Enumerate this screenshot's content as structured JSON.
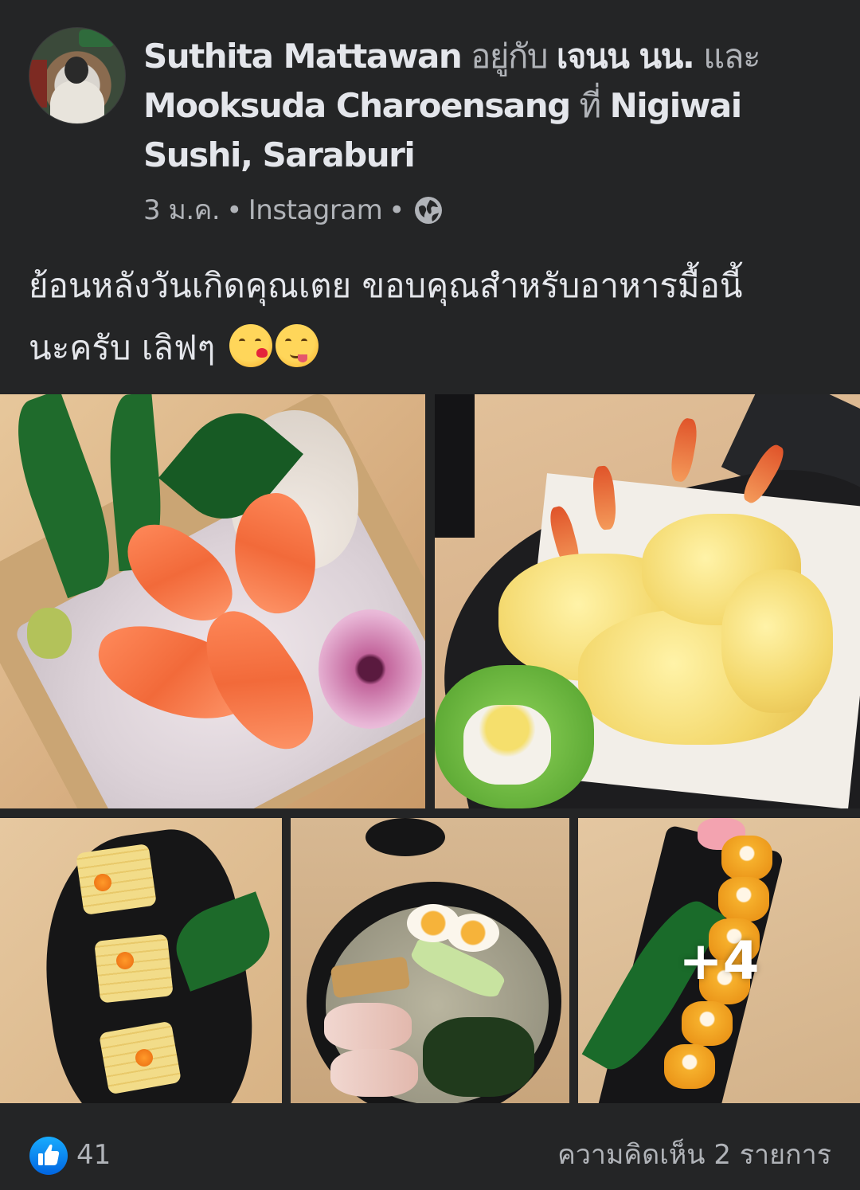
{
  "post": {
    "author_name": "Suthita Mattawan",
    "with_word": "อยู่กับ",
    "tagged_1": "เจนน นน.",
    "and_word": "และ",
    "tagged_2": "Mooksuda Charoensang",
    "at_word": "ที่",
    "location": "Nigiwai Sushi, Saraburi",
    "date": "3 ม.ค.",
    "source": "Instagram",
    "privacy_icon": "globe-icon",
    "caption_line1": "ย้อนหลังวันเกิดคุณเตย ขอบคุณสำหรับอาหารมื้อนี้",
    "caption_line2": "นะครับ เลิฟๆ",
    "emojis": [
      "kissing-heart-emoji",
      "yum-face-emoji"
    ],
    "photos": [
      {
        "name": "salmon-sashimi-photo"
      },
      {
        "name": "shrimp-tempura-photo"
      },
      {
        "name": "tamago-sushi-photo"
      },
      {
        "name": "ramen-photo"
      },
      {
        "name": "sushi-roll-photo",
        "more_count": "+4"
      }
    ]
  },
  "footer": {
    "like_icon": "like-thumb-icon",
    "like_count": "41",
    "comments_text": "ความคิดเห็น 2 รายการ"
  },
  "colors": {
    "background": "#242526",
    "primary_text": "#e4e6eb",
    "secondary_text": "#b0b3b8",
    "like_blue": "#1877f2"
  }
}
